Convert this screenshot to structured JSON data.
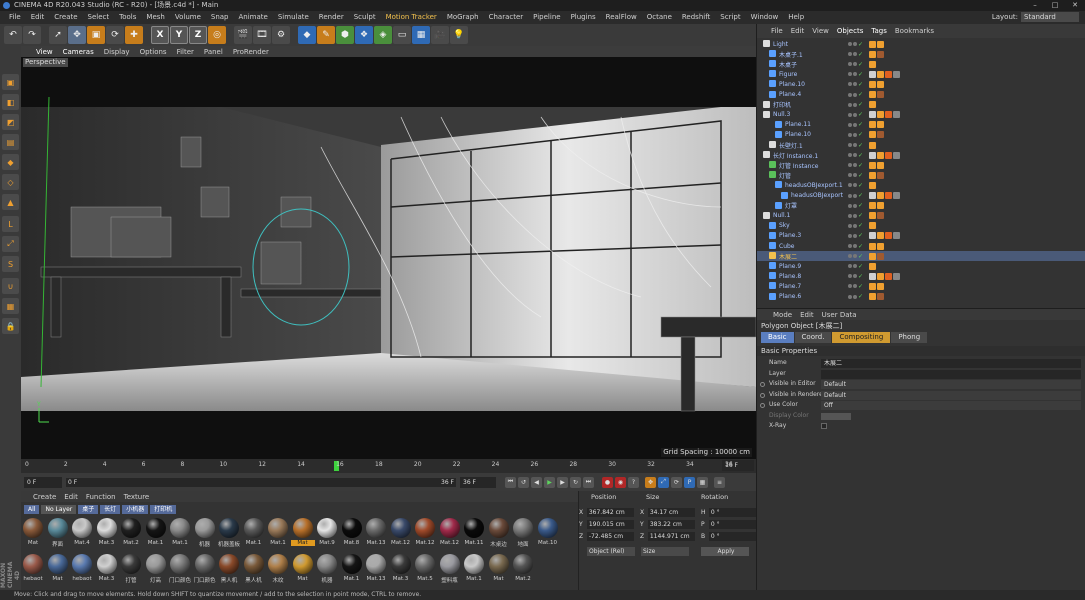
{
  "window": {
    "title": "CINEMA 4D R20.043 Studio (RC - R20) - [场景.c4d *] - Main"
  },
  "menu": [
    "File",
    "Edit",
    "Create",
    "Select",
    "Tools",
    "Mesh",
    "Volume",
    "Snap",
    "Animate",
    "Simulate",
    "Render",
    "Sculpt",
    "Motion Tracker",
    "MoGraph",
    "Character",
    "Pipeline",
    "Plugins",
    "RealFlow",
    "Octane",
    "Redshift",
    "Script",
    "Window",
    "Help"
  ],
  "layout": {
    "label": "Layout:",
    "value": "Standard"
  },
  "viewport": {
    "menu": [
      "View",
      "Cameras",
      "Display",
      "Options",
      "Filter",
      "Panel",
      "ProRender"
    ],
    "label": "Perspective",
    "grid_spacing": "Grid Spacing : 10000 cm"
  },
  "timeline": {
    "ticks": [
      "0",
      "2",
      "4",
      "6",
      "8",
      "10",
      "12",
      "14",
      "16",
      "18",
      "20",
      "22",
      "24",
      "26",
      "28",
      "30",
      "32",
      "34",
      "36"
    ],
    "end_frame": "16 F",
    "current_frame": 16,
    "total_frames": 36
  },
  "playback": {
    "start": "0 F",
    "range_start": "0 F",
    "range_end": "36 F",
    "end": "36 F"
  },
  "material_manager": {
    "menu": [
      "Create",
      "Edit",
      "Function",
      "Texture"
    ],
    "filters": [
      "All",
      "No Layer",
      "桌子",
      "长灯",
      "小机器",
      "打印机"
    ],
    "materials": [
      {
        "label": "Mat",
        "color": "#8a5a3a"
      },
      {
        "label": "界面",
        "color": "#5a8a9a"
      },
      {
        "label": "Mat.4",
        "color": "#c9c9c9"
      },
      {
        "label": "Mat.3",
        "color": "#dcdcdc"
      },
      {
        "label": "Mat.2",
        "color": "#202020"
      },
      {
        "label": "Mat.1",
        "color": "#151515"
      },
      {
        "label": "Mat.1",
        "color": "#8a8a8a"
      },
      {
        "label": "机器",
        "color": "#9a9a9a"
      },
      {
        "label": "机器盖板",
        "color": "#2a3a4a"
      },
      {
        "label": "Mat.1",
        "color": "#5a5a5a"
      },
      {
        "label": "Mat.1",
        "color": "#9a7a5a"
      },
      {
        "label": "Mat",
        "color": "#b8702a"
      },
      {
        "label": "Mat.9",
        "color": "#e5e5e5"
      },
      {
        "label": "Mat.8",
        "color": "#0c0c0c"
      },
      {
        "label": "Mat.13",
        "color": "#6a6a6a"
      },
      {
        "label": "Mat.12",
        "color": "#3a4a6a"
      },
      {
        "label": "Mat.12",
        "color": "#a04a2a"
      },
      {
        "label": "Mat.12",
        "color": "#a02a4a"
      },
      {
        "label": "Mat.11",
        "color": "#0a0a0a"
      },
      {
        "label": "木桌边",
        "color": "#6a4a3a"
      },
      {
        "label": "地面",
        "color": "#7a7a7a"
      },
      {
        "label": "Mat.10",
        "color": "#3a5a8a"
      },
      {
        "label": "hebaot",
        "color": "#9a5a4a"
      },
      {
        "label": "Mat",
        "color": "#4a6a9a"
      },
      {
        "label": "hebaot",
        "color": "#5a7ab0"
      },
      {
        "label": "Mat.3",
        "color": "#d0d0d0"
      },
      {
        "label": "打管",
        "color": "#3a3a3a"
      },
      {
        "label": "灯高",
        "color": "#9a9a9a"
      },
      {
        "label": "门口颜色",
        "color": "#7a7a7a"
      },
      {
        "label": "门口颜色",
        "color": "#6a6a6a"
      },
      {
        "label": "黑人机",
        "color": "#8a4a2a"
      },
      {
        "label": "黑人机",
        "color": "#7a5a3a"
      },
      {
        "label": "木纹",
        "color": "#b0804a"
      },
      {
        "label": "Mat",
        "color": "#d09a30"
      },
      {
        "label": "机器",
        "color": "#8a8a8a"
      },
      {
        "label": "Mat.1",
        "color": "#151515"
      },
      {
        "label": "Mat.13",
        "color": "#aaaaaa"
      },
      {
        "label": "Mat.3",
        "color": "#3a3a3a"
      },
      {
        "label": "Mat.5",
        "color": "#6a6a6a"
      },
      {
        "label": "塑料瓶",
        "color": "#9a9aa0"
      },
      {
        "label": "Mat.1",
        "color": "#c9c9c9"
      },
      {
        "label": "Mat",
        "color": "#7a6a50"
      },
      {
        "label": "Mat.2",
        "color": "#555555"
      }
    ],
    "selected_index": 11
  },
  "coordinates": {
    "headers": [
      "Position",
      "Size",
      "Rotation"
    ],
    "rows": [
      {
        "axis": "X",
        "pos": "367.842 cm",
        "size_axis": "X",
        "size": "34.17 cm",
        "rot_axis": "H",
        "rot": "0 °"
      },
      {
        "axis": "Y",
        "pos": "190.015 cm",
        "size_axis": "Y",
        "size": "383.22 cm",
        "rot_axis": "P",
        "rot": "0 °"
      },
      {
        "axis": "Z",
        "pos": "-72.485 cm",
        "size_axis": "Z",
        "size": "1144.971 cm",
        "rot_axis": "B",
        "rot": "0 °"
      }
    ],
    "mode_select": "Object (Rel)",
    "size_select": "Size",
    "apply": "Apply"
  },
  "object_manager": {
    "menu": [
      "File",
      "Edit",
      "View",
      "Objects",
      "Tags",
      "Bookmarks"
    ],
    "objects": [
      {
        "name": "Light",
        "indent": 0,
        "icon": "#ddd"
      },
      {
        "name": "木桌子.1",
        "indent": 1,
        "icon": "#5aa0ff"
      },
      {
        "name": "木桌子",
        "indent": 1,
        "icon": "#5aa0ff"
      },
      {
        "name": "Figure",
        "indent": 1,
        "icon": "#5aa0ff"
      },
      {
        "name": "Plane.10",
        "indent": 1,
        "icon": "#5aa0ff"
      },
      {
        "name": "Plane.4",
        "indent": 1,
        "icon": "#5aa0ff"
      },
      {
        "name": "打印机",
        "indent": 0,
        "icon": "#ddd"
      },
      {
        "name": "Null.3",
        "indent": 0,
        "icon": "#ddd"
      },
      {
        "name": "Plane.11",
        "indent": 2,
        "icon": "#5aa0ff"
      },
      {
        "name": "Plane.10",
        "indent": 2,
        "icon": "#5aa0ff"
      },
      {
        "name": "长壁灯.1",
        "indent": 1,
        "icon": "#ddd"
      },
      {
        "name": "长灯 Instance.1",
        "indent": 0,
        "icon": "#ddd"
      },
      {
        "name": "灯管 Instance",
        "indent": 1,
        "icon": "#5ac05a"
      },
      {
        "name": "灯管",
        "indent": 1,
        "icon": "#5ac05a"
      },
      {
        "name": "headusOBJexport.1",
        "indent": 2,
        "icon": "#5aa0ff"
      },
      {
        "name": "headusOBJexport",
        "indent": 3,
        "icon": "#5aa0ff"
      },
      {
        "name": "灯罩",
        "indent": 2,
        "icon": "#5aa0ff"
      },
      {
        "name": "Null.1",
        "indent": 0,
        "icon": "#ddd"
      },
      {
        "name": "Sky",
        "indent": 1,
        "icon": "#5aa0ff"
      },
      {
        "name": "Plane.3",
        "indent": 1,
        "icon": "#5aa0ff"
      },
      {
        "name": "Cube",
        "indent": 1,
        "icon": "#5aa0ff"
      },
      {
        "name": "木展二",
        "indent": 1,
        "icon": "#f2c14e",
        "selected": true
      },
      {
        "name": "Plane.9",
        "indent": 1,
        "icon": "#5aa0ff"
      },
      {
        "name": "Plane.8",
        "indent": 1,
        "icon": "#5aa0ff"
      },
      {
        "name": "Plane.7",
        "indent": 1,
        "icon": "#5aa0ff"
      },
      {
        "name": "Plane.6",
        "indent": 1,
        "icon": "#5aa0ff"
      }
    ]
  },
  "attributes": {
    "menu": [
      "Mode",
      "Edit",
      "User Data"
    ],
    "object_title": "Polygon Object [木展二]",
    "tabs": [
      "Basic",
      "Coord.",
      "Compositing",
      "Phong"
    ],
    "section": "Basic Properties",
    "props": [
      {
        "label": "Name",
        "value": "木展二"
      },
      {
        "label": "Layer",
        "value": ""
      },
      {
        "label": "Visible in Editor",
        "value": "Default"
      },
      {
        "label": "Visible in Renderer",
        "value": "Default"
      },
      {
        "label": "Use Color",
        "value": "Off"
      },
      {
        "label": "Display Color",
        "value": ""
      },
      {
        "label": "X-Ray",
        "value": ""
      }
    ]
  },
  "status": "Move: Click and drag to move elements. Hold down SHIFT to quantize movement / add to the selection in point mode, CTRL to remove.",
  "brand": "MAXON CINEMA 4D"
}
